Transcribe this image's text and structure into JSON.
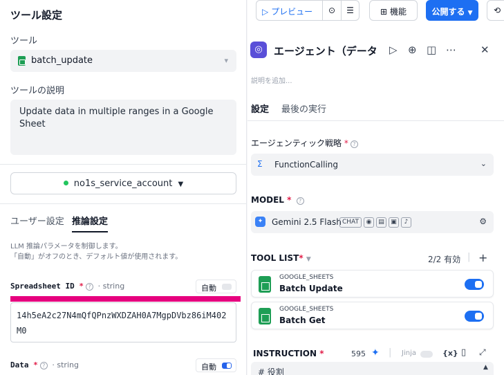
{
  "left": {
    "panel_title": "ツール設定",
    "tool_label": "ツール",
    "tool_value": "batch_update",
    "tool_desc_label": "ツールの説明",
    "tool_desc": "Update data in multiple ranges in a Google Sheet",
    "account": "no1s_service_account",
    "tabs": [
      "ユーザー設定",
      "推論設定"
    ],
    "active_tab": "推論設定",
    "hint_line1": "LLM 推論パラメータを制御します。",
    "hint_line2": "「自動」がオフのとき、デフォルト値が使用されます。",
    "fields": [
      {
        "name": "Spreadsheet ID",
        "type": "string",
        "auto_label": "自動",
        "auto_on": false,
        "value": "14h5eA2c27N4mQfQPnzWXDZAH0A7MgpDVbz86iM402M0"
      },
      {
        "name": "Data",
        "type": "string",
        "auto_label": "自動",
        "auto_on": true
      }
    ],
    "type_prefix": "· ",
    "required_mark": "*",
    "highlight_color": "#e6007e"
  },
  "right": {
    "toolbar": {
      "preview": "プレビュー",
      "features": "機能",
      "publish": "公開する"
    },
    "agent_title": "エージェント（データ記録",
    "desc_placeholder": "説明を追加...",
    "tabs": [
      "設定",
      "最後の実行"
    ],
    "active_tab": "設定",
    "strategy_label": "エージェンティック戦略",
    "strategy_value": "FunctionCalling",
    "model_label": "MODEL",
    "model_value": "Gemini 2.5 Flash",
    "model_chip": "CHAT",
    "tool_list_label": "TOOL LIST",
    "tool_count": "2/2 有効",
    "tools": [
      {
        "category": "GOOGLE_SHEETS",
        "name": "Batch Update",
        "enabled": true
      },
      {
        "category": "GOOGLE_SHEETS",
        "name": "Batch Get",
        "enabled": true
      }
    ],
    "instruction_label": "INSTRUCTION",
    "instruction_count": "595",
    "jinja_label": "Jinja",
    "var_label": "{x}",
    "instruction_preview": "# 役割",
    "required_mark": "*",
    "accent": "#1d6ff2"
  }
}
